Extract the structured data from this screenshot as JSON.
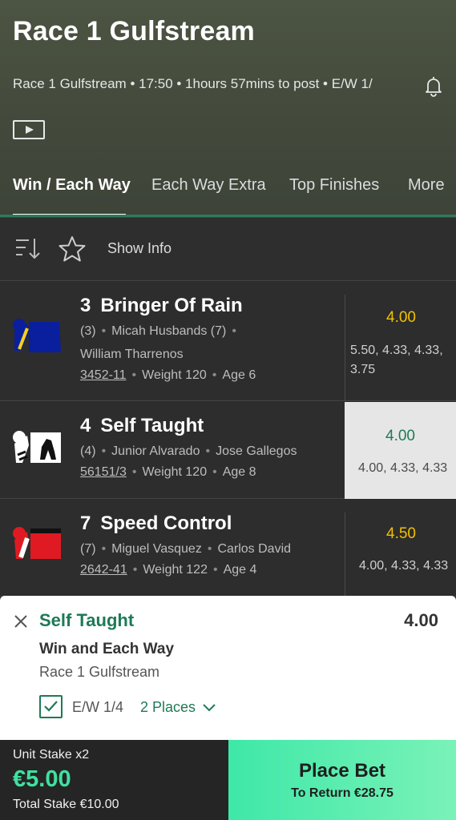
{
  "header": {
    "title": "Race 1 Gulfstream",
    "info": "Race 1 Gulfstream • 17:50 • 1hours 57mins to post • E/W 1/"
  },
  "tabs": [
    {
      "label": "Win / Each Way",
      "active": true
    },
    {
      "label": "Each Way Extra"
    },
    {
      "label": "Top Finishes"
    },
    {
      "label": "More"
    }
  ],
  "toolbar": {
    "show_info": "Show Info"
  },
  "runners": [
    {
      "number": "3",
      "name": "Bringer Of Rain",
      "line1": [
        "(3)",
        "Micah Husbands (7)"
      ],
      "line2": [
        "William Tharrenos"
      ],
      "form": "3452-11",
      "weight": "Weight 120",
      "age": "Age 6",
      "odds": "4.00",
      "odds_history": "5.50, 4.33, 4.33, 3.75",
      "silk_colors": {
        "body": "#0a1f9e",
        "cap": "#0a1f9e",
        "stripe": "#f4d21a"
      }
    },
    {
      "number": "4",
      "name": "Self Taught",
      "line1": [
        "(4)",
        "Junior Alvarado",
        "Jose Gallegos"
      ],
      "form": "56151/3",
      "weight": "Weight 120",
      "age": "Age 8",
      "odds": "4.00",
      "odds_history": "4.00, 4.33, 4.33",
      "selected": true,
      "silk_colors": {
        "body": "#ffffff",
        "cap": "#ffffff",
        "stripe": "#111111"
      }
    },
    {
      "number": "7",
      "name": "Speed Control",
      "line1": [
        "(7)",
        "Miguel Vasquez",
        "Carlos David"
      ],
      "form": "2642-41",
      "weight": "Weight 122",
      "age": "Age 4",
      "odds": "4.50",
      "odds_history": "4.00, 4.33, 4.33",
      "silk_colors": {
        "body": "#e01a22",
        "cap": "#e01a22",
        "stripe": "#ffffff"
      }
    }
  ],
  "betslip": {
    "selection": "Self Taught",
    "odds": "4.00",
    "market": "Win and Each Way",
    "event": "Race 1 Gulfstream",
    "ew_label": "E/W  1/4",
    "places": "2 Places",
    "ew_checked": true
  },
  "footer": {
    "unit_stake_label": "Unit Stake x2",
    "stake_amount": "€5.00",
    "total_stake": "Total Stake  €10.00",
    "place_bet": "Place Bet",
    "to_return": "To Return €28.75"
  },
  "colors": {
    "accent": "#1e7a56",
    "odds_yellow": "#f2c200",
    "cta_green": "#3ee8a8"
  }
}
